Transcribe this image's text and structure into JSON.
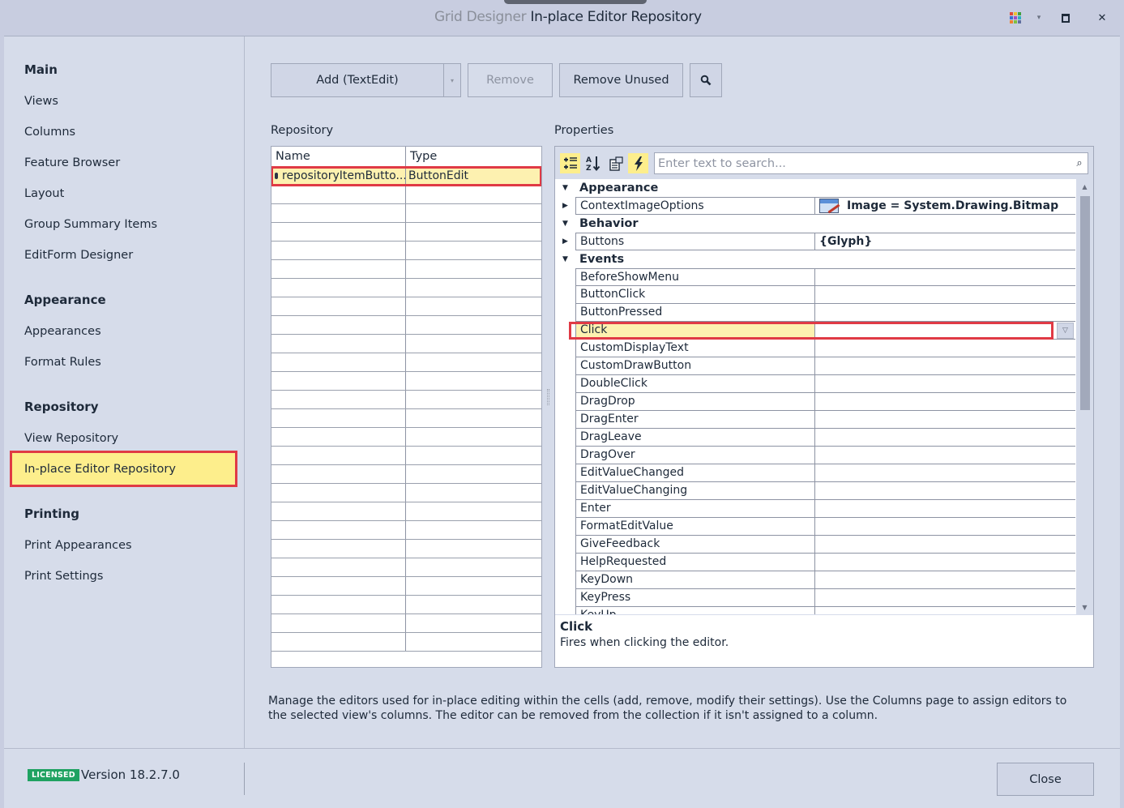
{
  "window": {
    "title_prefix": "Grid Designer",
    "title_main": "In-place Editor Repository",
    "controls": {
      "maximize_label": "",
      "close_label": "✕",
      "dropdown_label": "▾"
    }
  },
  "sidebar": {
    "groups": [
      {
        "label": "Main",
        "items": [
          "Views",
          "Columns",
          "Feature Browser",
          "Layout",
          "Group Summary Items",
          "EditForm Designer"
        ]
      },
      {
        "label": "Appearance",
        "items": [
          "Appearances",
          "Format Rules"
        ]
      },
      {
        "label": "Repository",
        "items": [
          "View Repository",
          "In-place Editor Repository"
        ]
      },
      {
        "label": "Printing",
        "items": [
          "Print Appearances",
          "Print Settings"
        ]
      }
    ],
    "active_item": "In-place Editor Repository"
  },
  "toolbar": {
    "add_label": "Add (TextEdit)",
    "add_dropdown_label": "▾",
    "remove_label": "Remove",
    "remove_unused_label": "Remove Unused",
    "search_icon": "search-icon"
  },
  "repository": {
    "label": "Repository",
    "columns": [
      "Name",
      "Type"
    ],
    "rows": [
      {
        "name": "repositoryItemButto...",
        "type": "ButtonEdit",
        "selected": true
      }
    ]
  },
  "properties": {
    "label": "Properties",
    "search_placeholder": "Enter text to search...",
    "tools": [
      "categorized-icon",
      "alphabetical-icon",
      "property-pages-icon",
      "events-icon"
    ],
    "categories": [
      {
        "label": "Appearance",
        "rows": [
          {
            "name": "ContextImageOptions",
            "value": "Image = System.Drawing.Bitmap",
            "expandable": true,
            "icon": "image-icon"
          }
        ]
      },
      {
        "label": "Behavior",
        "rows": [
          {
            "name": "Buttons",
            "value": "{Glyph}",
            "expandable": true
          }
        ]
      },
      {
        "label": "Events",
        "rows": [
          {
            "name": "BeforeShowMenu",
            "value": ""
          },
          {
            "name": "ButtonClick",
            "value": ""
          },
          {
            "name": "ButtonPressed",
            "value": ""
          },
          {
            "name": "Click",
            "value": "",
            "selected": true
          },
          {
            "name": "CustomDisplayText",
            "value": ""
          },
          {
            "name": "CustomDrawButton",
            "value": ""
          },
          {
            "name": "DoubleClick",
            "value": ""
          },
          {
            "name": "DragDrop",
            "value": ""
          },
          {
            "name": "DragEnter",
            "value": ""
          },
          {
            "name": "DragLeave",
            "value": ""
          },
          {
            "name": "DragOver",
            "value": ""
          },
          {
            "name": "EditValueChanged",
            "value": ""
          },
          {
            "name": "EditValueChanging",
            "value": ""
          },
          {
            "name": "Enter",
            "value": ""
          },
          {
            "name": "FormatEditValue",
            "value": ""
          },
          {
            "name": "GiveFeedback",
            "value": ""
          },
          {
            "name": "HelpRequested",
            "value": ""
          },
          {
            "name": "KeyDown",
            "value": ""
          },
          {
            "name": "KeyPress",
            "value": ""
          },
          {
            "name": "KeyUp",
            "value": ""
          }
        ]
      }
    ],
    "description": {
      "title": "Click",
      "text": "Fires when clicking the editor."
    }
  },
  "help_text": "Manage the editors used for in-place editing within the cells (add, remove, modify their settings). Use the Columns page to assign editors to the selected view's columns. The editor can be removed from the collection if it isn't assigned to a column.",
  "footer": {
    "license_badge": "LICENSED",
    "version": "Version 18.2.7.0",
    "close_label": "Close"
  },
  "colors": {
    "accent_highlight": "#fdee8c",
    "selection_border": "#e03a45",
    "license_green": "#1fa261"
  }
}
